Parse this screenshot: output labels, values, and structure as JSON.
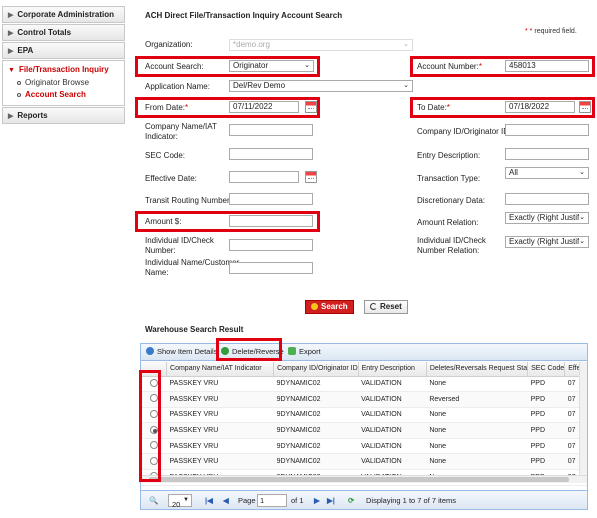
{
  "sidebar": {
    "items": [
      {
        "label": "Corporate Administration"
      },
      {
        "label": "Control Totals"
      },
      {
        "label": "EPA"
      }
    ],
    "open_section": {
      "label": "File/Transaction Inquiry",
      "subitems": [
        {
          "label": "Originator Browse"
        },
        {
          "label": "Account Search"
        }
      ]
    },
    "last_item": {
      "label": "Reports"
    }
  },
  "page": {
    "title": "ACH Direct File/Transaction Inquiry Account Search",
    "required_text": "required field.",
    "required_star": "* *"
  },
  "form": {
    "organization": {
      "label": "Organization:",
      "value": "*demo.org"
    },
    "account_search": {
      "label": "Account Search:",
      "value": "Originator"
    },
    "account_number": {
      "label": "Account Number:",
      "value": "458013"
    },
    "application_name": {
      "label": "Application Name:",
      "value": "Del/Rev Demo"
    },
    "from_date": {
      "label": "From Date:",
      "value": "07/11/2022"
    },
    "to_date": {
      "label": "To Date:",
      "value": "07/18/2022"
    },
    "company_name": {
      "label1": "Company Name/IAT",
      "label2": "Indicator:",
      "value": ""
    },
    "company_id": {
      "label": "Company ID/Originator ID:",
      "value": ""
    },
    "sec_code": {
      "label": "SEC Code:",
      "value": ""
    },
    "entry_description": {
      "label": "Entry Description:",
      "value": ""
    },
    "effective_date": {
      "label": "Effective Date:",
      "value": ""
    },
    "transaction_type": {
      "label": "Transaction Type:",
      "value": "All"
    },
    "transit_routing": {
      "label": "Transit Routing Number:",
      "value": ""
    },
    "discretionary_data": {
      "label": "Discretionary Data:",
      "value": ""
    },
    "amount": {
      "label": "Amount $:",
      "value": ""
    },
    "amount_relation": {
      "label": "Amount Relation:",
      "value": "Exactly (Right Justifie"
    },
    "individual_id": {
      "label1": "Individual ID/Check",
      "label2": "Number:",
      "value": ""
    },
    "individual_id_relation": {
      "label1": "Individual ID/Check",
      "label2": "Number Relation:",
      "value": "Exactly (Right Justifie"
    },
    "individual_name": {
      "label1": "Individual Name/Customer",
      "label2": "Name:",
      "value": ""
    }
  },
  "buttons": {
    "search": "Search",
    "reset": "Reset"
  },
  "results": {
    "title": "Warehouse Search Result",
    "toolbar": {
      "show_details": "Show Item Details",
      "delete_reverse": "Delete/Reverse",
      "export": "Export"
    },
    "columns": [
      "",
      "Company Name/IAT Indicator",
      "Company ID/Originator ID",
      "Entry Description",
      "Deletes/Reversals Request Sta",
      "SEC Code",
      "Effect"
    ],
    "rows": [
      {
        "selected": false,
        "company": "PASSKEY VRU",
        "company_id": "9DYNAMIC02",
        "entry": "VALIDATION",
        "status": "None",
        "sec": "PPD",
        "eff": "07"
      },
      {
        "selected": false,
        "company": "PASSKEY VRU",
        "company_id": "9DYNAMIC02",
        "entry": "VALIDATION",
        "status": "Reversed",
        "sec": "PPD",
        "eff": "07"
      },
      {
        "selected": false,
        "company": "PASSKEY VRU",
        "company_id": "9DYNAMIC02",
        "entry": "VALIDATION",
        "status": "None",
        "sec": "PPD",
        "eff": "07"
      },
      {
        "selected": true,
        "company": "PASSKEY VRU",
        "company_id": "9DYNAMIC02",
        "entry": "VALIDATION",
        "status": "None",
        "sec": "PPD",
        "eff": "07"
      },
      {
        "selected": false,
        "company": "PASSKEY VRU",
        "company_id": "9DYNAMIC02",
        "entry": "VALIDATION",
        "status": "None",
        "sec": "PPD",
        "eff": "07"
      },
      {
        "selected": false,
        "company": "PASSKEY VRU",
        "company_id": "9DYNAMIC02",
        "entry": "VALIDATION",
        "status": "None",
        "sec": "PPD",
        "eff": "07"
      },
      {
        "selected": false,
        "company": "PASSKEY VRU",
        "company_id": "9DYNAMIC02",
        "entry": "VALIDATION",
        "status": "None",
        "sec": "PPD",
        "eff": "07"
      }
    ],
    "pager": {
      "page_size": "20",
      "page_label": "Page",
      "page_value": "1",
      "of_label": "of 1",
      "displaying": "Displaying 1 to 7 of 7 items"
    }
  },
  "colors": {
    "highlight": "#e00012",
    "accent_red": "#c00000",
    "grid_border": "#99bbe8"
  }
}
